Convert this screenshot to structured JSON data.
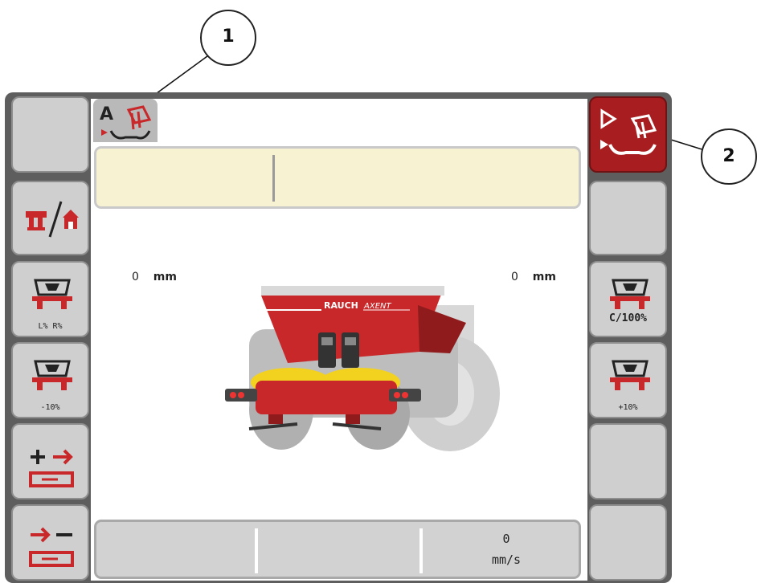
{
  "callouts": {
    "one": "1",
    "two": "2"
  },
  "display": {
    "left_width_value": "0",
    "left_width_unit": "mm",
    "right_width_value": "0",
    "right_width_unit": "mm",
    "speed_value": "0",
    "speed_unit": "mm/s",
    "brand_label": "RAUCH",
    "model_label": "AXENT"
  },
  "left_buttons": {
    "btn3_label": "L%   R%",
    "btn4_label": "-10%"
  },
  "right_buttons": {
    "btn3_label": "C/100%",
    "btn4_label": "+10%"
  },
  "colors": {
    "frame": "#5e5e5e",
    "button": "#cfcfcf",
    "active_button": "#a81d1f",
    "spreader_red": "#c8282a",
    "spreader_yellow": "#f2d21e",
    "info_bar": "#f7f3d2"
  }
}
